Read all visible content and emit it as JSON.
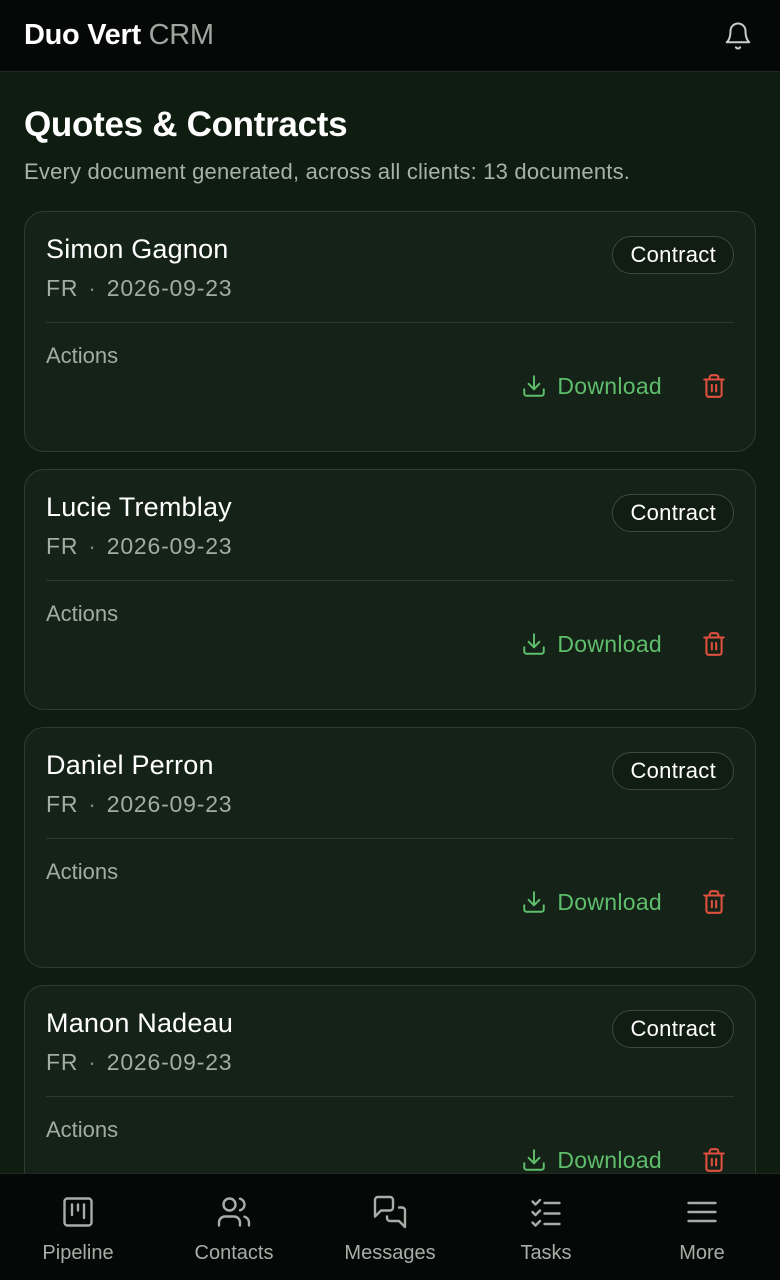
{
  "app": {
    "brand_main": "Duo Vert",
    "brand_sub": "CRM"
  },
  "page": {
    "title": "Quotes & Contracts",
    "subtitle": "Every document generated, across all clients: 13 documents."
  },
  "documents": [
    {
      "client": "Simon Gagnon",
      "lang": "FR",
      "separator": "·",
      "date": "2026-09-23",
      "type": "Contract",
      "actions_label": "Actions",
      "download_label": "Download"
    },
    {
      "client": "Lucie Tremblay",
      "lang": "FR",
      "separator": "·",
      "date": "2026-09-23",
      "type": "Contract",
      "actions_label": "Actions",
      "download_label": "Download"
    },
    {
      "client": "Daniel Perron",
      "lang": "FR",
      "separator": "·",
      "date": "2026-09-23",
      "type": "Contract",
      "actions_label": "Actions",
      "download_label": "Download"
    },
    {
      "client": "Manon Nadeau",
      "lang": "FR",
      "separator": "·",
      "date": "2026-09-23",
      "type": "Contract",
      "actions_label": "Actions",
      "download_label": "Download"
    }
  ],
  "nav": [
    {
      "label": "Pipeline",
      "icon": "pipeline-icon"
    },
    {
      "label": "Contacts",
      "icon": "contacts-icon"
    },
    {
      "label": "Messages",
      "icon": "messages-icon"
    },
    {
      "label": "Tasks",
      "icon": "tasks-icon"
    },
    {
      "label": "More",
      "icon": "menu-icon"
    }
  ],
  "colors": {
    "accent_green": "#5fbe6c",
    "danger_red": "#e0503f",
    "background": "#0f1c10",
    "card": "#142217"
  }
}
